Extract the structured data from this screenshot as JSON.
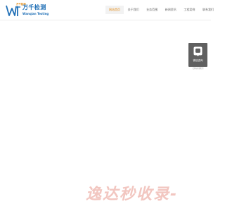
{
  "brand": {
    "mark_text": "万千检测",
    "name_cn": "万千检测",
    "name_en": "Wanqian Testing"
  },
  "nav": {
    "items": [
      {
        "label": "网站首页",
        "active": true
      },
      {
        "label": "关于我们",
        "active": false
      },
      {
        "label": "业务范围",
        "active": false
      },
      {
        "label": "新闻资讯",
        "active": false
      },
      {
        "label": "工程案例",
        "active": false
      },
      {
        "label": "联系我们",
        "active": false
      }
    ]
  },
  "side_widget": {
    "icon": "qr-code-icon",
    "label": "微信咨询",
    "caption": "扫码关注我们"
  },
  "watermark": {
    "text": "逸达秒收录-"
  },
  "colors": {
    "brand_blue": "#1f6fb6",
    "accent_orange": "#e58a12",
    "widget_bg": "#5f5f5f"
  }
}
